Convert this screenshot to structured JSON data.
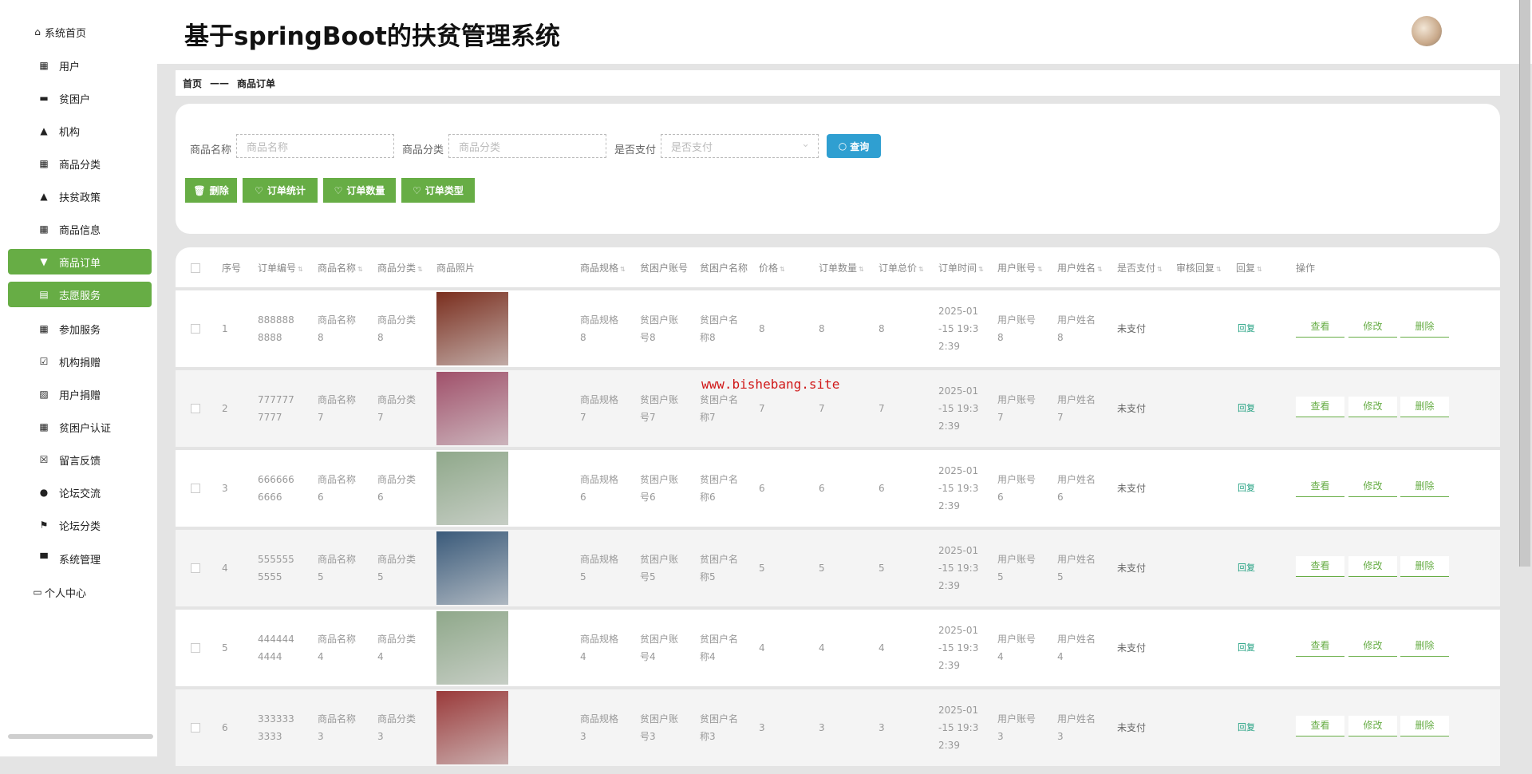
{
  "header": {
    "title": "基于springBoot的扶贫管理系统"
  },
  "sidebar": {
    "items": [
      {
        "label": "系统首页",
        "icon": "home-icon",
        "glyph": "⌂",
        "plain": true
      },
      {
        "label": "用户",
        "icon": "grid-icon",
        "glyph": "▦"
      },
      {
        "label": "贫困户",
        "icon": "briefcase-icon",
        "glyph": "▬"
      },
      {
        "label": "机构",
        "icon": "user-icon",
        "glyph": "▲"
      },
      {
        "label": "商品分类",
        "icon": "grid-icon",
        "glyph": "▦"
      },
      {
        "label": "扶贫政策",
        "icon": "user-icon",
        "glyph": "▲"
      },
      {
        "label": "商品信息",
        "icon": "grid-icon",
        "glyph": "▦"
      },
      {
        "label": "商品订单",
        "icon": "cup-icon",
        "glyph": "▼",
        "active": true
      },
      {
        "label": "志愿服务",
        "icon": "clipboard-icon",
        "glyph": "▤",
        "active": true
      },
      {
        "label": "参加服务",
        "icon": "grid-icon",
        "glyph": "▦"
      },
      {
        "label": "机构捐赠",
        "icon": "clipboard-check-icon",
        "glyph": "☑"
      },
      {
        "label": "用户捐赠",
        "icon": "chart-icon",
        "glyph": "▨"
      },
      {
        "label": "贫困户认证",
        "icon": "grid-icon",
        "glyph": "▦"
      },
      {
        "label": "留言反馈",
        "icon": "clipboard-x-icon",
        "glyph": "☒"
      },
      {
        "label": "论坛交流",
        "icon": "bulb-icon",
        "glyph": "●"
      },
      {
        "label": "论坛分类",
        "icon": "flag-icon",
        "glyph": "⚑"
      },
      {
        "label": "系统管理",
        "icon": "monitor-icon",
        "glyph": "▀"
      },
      {
        "label": "个人中心",
        "icon": "wallet-icon",
        "glyph": "▭",
        "plain": true
      }
    ]
  },
  "breadcrumb": {
    "home": "首页",
    "sep": "——",
    "current": "商品订单"
  },
  "search": {
    "name_label": "商品名称",
    "name_placeholder": "商品名称",
    "category_label": "商品分类",
    "category_placeholder": "商品分类",
    "paid_label": "是否支付",
    "paid_placeholder": "是否支付",
    "query_button": "查询"
  },
  "actions": {
    "delete": "删除",
    "stats": "订单统计",
    "count": "订单数量",
    "type": "订单类型"
  },
  "table": {
    "columns": [
      "序号",
      "订单编号",
      "商品名称",
      "商品分类",
      "商品照片",
      "商品规格",
      "贫困户账号",
      "贫困户名称",
      "价格",
      "订单数量",
      "订单总价",
      "订单时间",
      "用户账号",
      "用户姓名",
      "是否支付",
      "审核回复",
      "回复",
      "操作"
    ],
    "rows": [
      {
        "no": "1",
        "order": "8888888888",
        "name": "商品名称8",
        "cat": "商品分类8",
        "spec": "商品规格8",
        "pacct": "贫困户账号8",
        "pname": "贫困户名称8",
        "price": "8",
        "qty": "8",
        "total": "8",
        "time": "2025-01-15 19:32:39",
        "uacct": "用户账号8",
        "uname": "用户姓名8",
        "paid": "未支付",
        "reply": "回复",
        "img": "#7a2e1e"
      },
      {
        "no": "2",
        "order": "7777777777",
        "name": "商品名称7",
        "cat": "商品分类7",
        "spec": "商品规格7",
        "pacct": "贫困户账号7",
        "pname": "贫困户名称7",
        "price": "7",
        "qty": "7",
        "total": "7",
        "time": "2025-01-15 19:32:39",
        "uacct": "用户账号7",
        "uname": "用户姓名7",
        "paid": "未支付",
        "reply": "回复",
        "img": "#a0506a"
      },
      {
        "no": "3",
        "order": "6666666666",
        "name": "商品名称6",
        "cat": "商品分类6",
        "spec": "商品规格6",
        "pacct": "贫困户账号6",
        "pname": "贫困户名称6",
        "price": "6",
        "qty": "6",
        "total": "6",
        "time": "2025-01-15 19:32:39",
        "uacct": "用户账号6",
        "uname": "用户姓名6",
        "paid": "未支付",
        "reply": "回复",
        "img": "#8fa88a"
      },
      {
        "no": "4",
        "order": "5555555555",
        "name": "商品名称5",
        "cat": "商品分类5",
        "spec": "商品规格5",
        "pacct": "贫困户账号5",
        "pname": "贫困户名称5",
        "price": "5",
        "qty": "5",
        "total": "5",
        "time": "2025-01-15 19:32:39",
        "uacct": "用户账号5",
        "uname": "用户姓名5",
        "paid": "未支付",
        "reply": "回复",
        "img": "#3a5a7a"
      },
      {
        "no": "5",
        "order": "4444444444",
        "name": "商品名称4",
        "cat": "商品分类4",
        "spec": "商品规格4",
        "pacct": "贫困户账号4",
        "pname": "贫困户名称4",
        "price": "4",
        "qty": "4",
        "total": "4",
        "time": "2025-01-15 19:32:39",
        "uacct": "用户账号4",
        "uname": "用户姓名4",
        "paid": "未支付",
        "reply": "回复",
        "img": "#8fa88a"
      },
      {
        "no": "6",
        "order": "3333333333",
        "name": "商品名称3",
        "cat": "商品分类3",
        "spec": "商品规格3",
        "pacct": "贫困户账号3",
        "pname": "贫困户名称3",
        "price": "3",
        "qty": "3",
        "total": "3",
        "time": "2025-01-15 19:32:39",
        "uacct": "用户账号3",
        "uname": "用户姓名3",
        "paid": "未支付",
        "reply": "回复",
        "img": "#9a3a3a"
      }
    ],
    "ops": {
      "view": "查看",
      "edit": "修改",
      "delete": "删除"
    }
  },
  "watermark": "www.bishebang.site",
  "colors": {
    "accent": "#67ad45",
    "query": "#2f9fd1"
  }
}
